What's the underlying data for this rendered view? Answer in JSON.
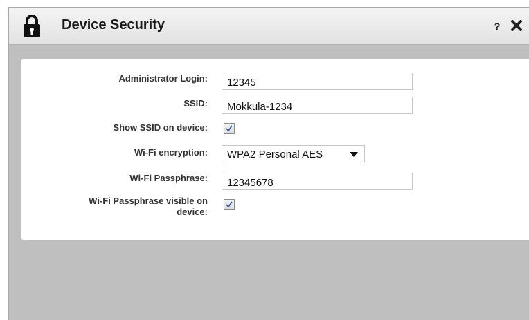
{
  "dialog": {
    "title": "Device Security",
    "help_label": "?"
  },
  "form": {
    "admin_login": {
      "label": "Administrator Login:",
      "value": "12345"
    },
    "ssid": {
      "label": "SSID:",
      "value": "Mokkula-1234"
    },
    "show_ssid": {
      "label": "Show SSID on device:",
      "checked": true
    },
    "encryption": {
      "label": "Wi-Fi encryption:",
      "value": "WPA2 Personal AES"
    },
    "passphrase": {
      "label": "Wi-Fi Passphrase:",
      "value": "12345678"
    },
    "passphrase_visible": {
      "label_line1": "Wi-Fi Passphrase visible on",
      "label_line2": "device:",
      "checked": true
    }
  },
  "colors": {
    "checkmark": "#3a5aa0",
    "background": "#bfbfbf"
  },
  "icons": {
    "title": "lock-icon",
    "close": "close-icon",
    "select": "chevron-down-icon",
    "check": "checkmark-icon"
  }
}
